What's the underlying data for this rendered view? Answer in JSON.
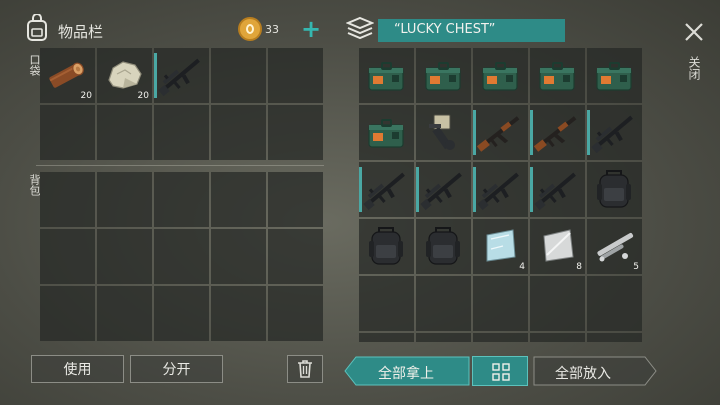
{
  "inventory": {
    "title": "物品栏",
    "coins": "33",
    "pocket_label": "口袋",
    "backpack_label": "背包"
  },
  "chest": {
    "title": "“LUCKY CHEST”"
  },
  "close_label": "关闭",
  "buttons": {
    "use": "使用",
    "split": "分开",
    "take_all": "全部拿上",
    "put_all": "全部放入"
  },
  "pocket_slots": [
    {
      "item": "wood-log",
      "qty": "20"
    },
    {
      "item": "stone",
      "qty": "20"
    },
    {
      "item": "assault-rifle",
      "qty": ""
    }
  ],
  "chest_slots": [
    {
      "item": "ammo-box",
      "qty": ""
    },
    {
      "item": "ammo-box",
      "qty": ""
    },
    {
      "item": "ammo-box",
      "qty": ""
    },
    {
      "item": "ammo-box",
      "qty": ""
    },
    {
      "item": "ammo-box",
      "qty": ""
    },
    {
      "item": "ammo-box",
      "qty": ""
    },
    {
      "item": "scope-launcher",
      "qty": ""
    },
    {
      "item": "ak-rifle",
      "qty": ""
    },
    {
      "item": "ak-rifle",
      "qty": ""
    },
    {
      "item": "assault-rifle",
      "qty": ""
    },
    {
      "item": "assault-rifle",
      "qty": ""
    },
    {
      "item": "assault-rifle",
      "qty": ""
    },
    {
      "item": "assault-rifle",
      "qty": ""
    },
    {
      "item": "assault-rifle",
      "qty": ""
    },
    {
      "item": "backpack",
      "qty": ""
    },
    {
      "item": "backpack",
      "qty": ""
    },
    {
      "item": "backpack",
      "qty": ""
    },
    {
      "item": "glass-pane",
      "qty": "4"
    },
    {
      "item": "metal-plate",
      "qty": "8"
    },
    {
      "item": "metal-parts",
      "qty": "5"
    }
  ],
  "colors": {
    "accent": "#2e8b87",
    "coin": "#e0a53a",
    "plus": "#35b7b0"
  }
}
